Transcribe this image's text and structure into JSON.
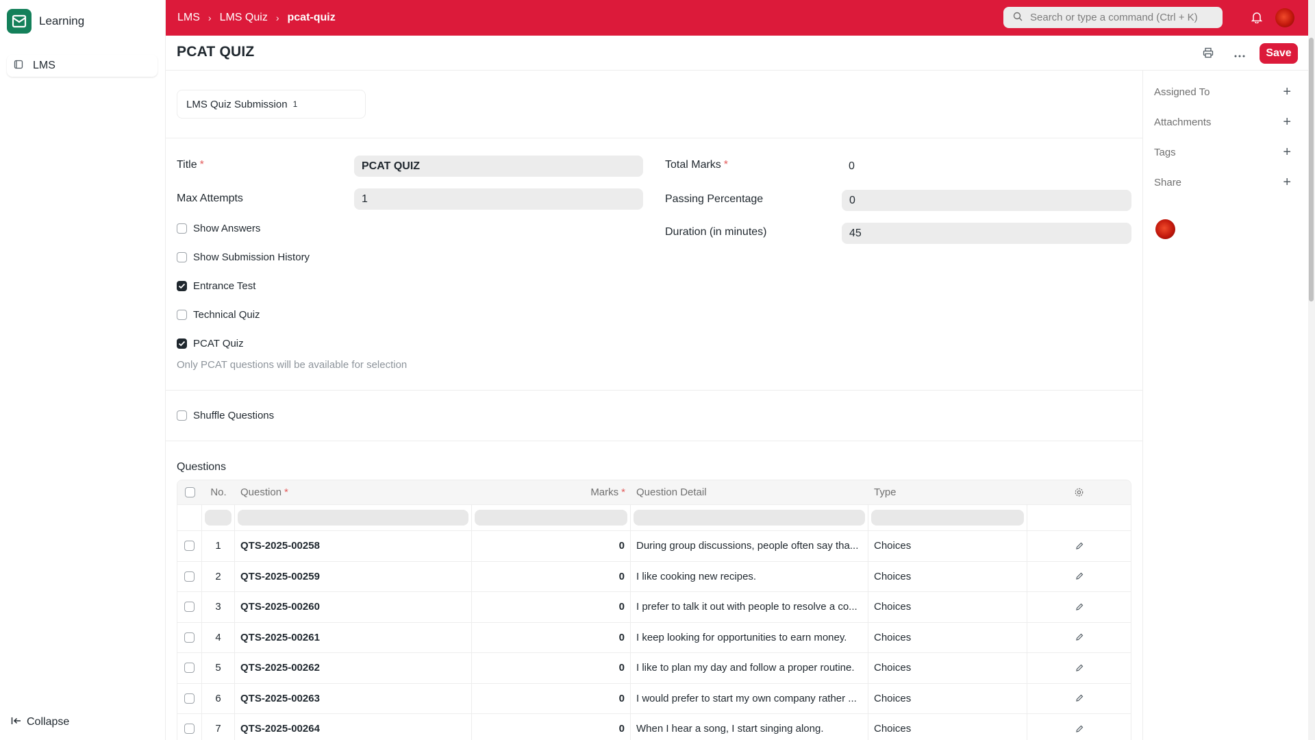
{
  "sidebar": {
    "app_title": "Learning",
    "items": [
      {
        "label": "LMS"
      }
    ],
    "collapse_label": "Collapse"
  },
  "navbar": {
    "breadcrumbs": [
      "LMS",
      "LMS Quiz",
      "pcat-quiz"
    ],
    "search_placeholder": "Search or type a command (Ctrl + K)",
    "accent_color": "#dc1a3a"
  },
  "page": {
    "title": "PCAT QUIZ",
    "save_label": "Save"
  },
  "connections": {
    "label": "LMS Quiz Submission",
    "count": "1"
  },
  "form": {
    "title_label": "Title",
    "title_value": "PCAT QUIZ",
    "max_attempts_label": "Max Attempts",
    "max_attempts_value": "1",
    "total_marks_label": "Total Marks",
    "total_marks_value": "0",
    "passing_percentage_label": "Passing Percentage",
    "passing_percentage_value": "0",
    "duration_label": "Duration (in minutes)",
    "duration_value": "45",
    "checkboxes": [
      {
        "label": "Show Answers",
        "checked": false
      },
      {
        "label": "Show Submission History",
        "checked": false
      },
      {
        "label": "Entrance Test",
        "checked": true
      },
      {
        "label": "Technical Quiz",
        "checked": false
      },
      {
        "label": "PCAT Quiz",
        "checked": true
      }
    ],
    "pcat_hint": "Only PCAT questions will be available for selection",
    "shuffle_label": "Shuffle Questions",
    "shuffle_checked": false
  },
  "questions": {
    "section_title": "Questions",
    "columns": {
      "no": "No.",
      "question": "Question",
      "marks": "Marks",
      "detail": "Question Detail",
      "type": "Type"
    },
    "rows": [
      {
        "no": "1",
        "question": "QTS-2025-00258",
        "marks": "0",
        "detail": "During group discussions, people often say tha...",
        "type": "Choices"
      },
      {
        "no": "2",
        "question": "QTS-2025-00259",
        "marks": "0",
        "detail": "I like cooking new recipes.",
        "type": "Choices"
      },
      {
        "no": "3",
        "question": "QTS-2025-00260",
        "marks": "0",
        "detail": "I prefer to talk it out with people to resolve a co...",
        "type": "Choices"
      },
      {
        "no": "4",
        "question": "QTS-2025-00261",
        "marks": "0",
        "detail": "I keep looking for opportunities to earn money.",
        "type": "Choices"
      },
      {
        "no": "5",
        "question": "QTS-2025-00262",
        "marks": "0",
        "detail": "I like to plan my day and follow a proper routine.",
        "type": "Choices"
      },
      {
        "no": "6",
        "question": "QTS-2025-00263",
        "marks": "0",
        "detail": "I would prefer to start my own company rather ...",
        "type": "Choices"
      },
      {
        "no": "7",
        "question": "QTS-2025-00264",
        "marks": "0",
        "detail": "When I hear a song, I start singing along.",
        "type": "Choices"
      }
    ]
  },
  "right_sidebar": {
    "items": [
      {
        "label": "Assigned To"
      },
      {
        "label": "Attachments"
      },
      {
        "label": "Tags"
      },
      {
        "label": "Share"
      }
    ]
  }
}
